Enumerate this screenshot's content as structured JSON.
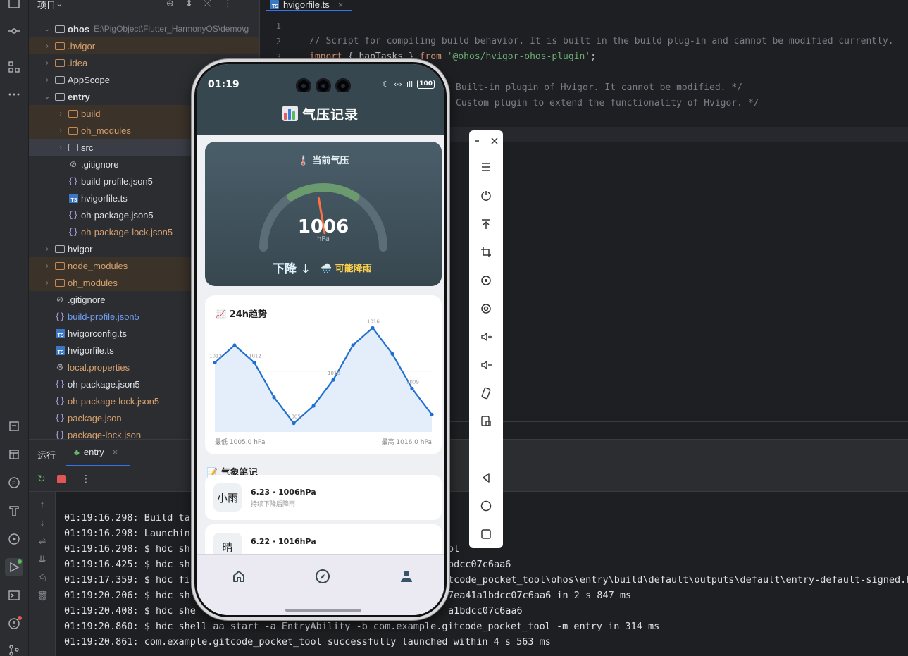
{
  "project": {
    "title": "项目",
    "root_name": "ohos",
    "root_path": "E:\\PigObject\\Flutter_HarmonyOS\\demo\\g",
    "tree": [
      {
        "label": ".hvigor",
        "type": "folder",
        "color": "orange",
        "depth": 1,
        "open": false,
        "hl": true
      },
      {
        "label": ".idea",
        "type": "folder",
        "color": "orange",
        "depth": 1,
        "open": false,
        "hl": false
      },
      {
        "label": "AppScope",
        "type": "folder",
        "color": "white",
        "depth": 1,
        "open": false,
        "hl": false
      },
      {
        "label": "entry",
        "type": "folder",
        "color": "white",
        "depth": 1,
        "open": true,
        "hl": false,
        "bold": true
      },
      {
        "label": "build",
        "type": "folder",
        "color": "orange",
        "depth": 2,
        "open": false,
        "hl": true
      },
      {
        "label": "oh_modules",
        "type": "folder",
        "color": "orange",
        "depth": 2,
        "open": false,
        "hl": true
      },
      {
        "label": "src",
        "type": "folder",
        "color": "white",
        "depth": 2,
        "open": false,
        "sel": true
      },
      {
        "label": ".gitignore",
        "type": "ignore",
        "color": "white",
        "depth": 2
      },
      {
        "label": "build-profile.json5",
        "type": "json",
        "color": "white",
        "depth": 2
      },
      {
        "label": "hvigorfile.ts",
        "type": "ts",
        "color": "white",
        "depth": 2
      },
      {
        "label": "oh-package.json5",
        "type": "json",
        "color": "white",
        "depth": 2
      },
      {
        "label": "oh-package-lock.json5",
        "type": "json",
        "color": "orange",
        "depth": 2
      },
      {
        "label": "hvigor",
        "type": "folder",
        "color": "white",
        "depth": 1,
        "open": false
      },
      {
        "label": "node_modules",
        "type": "folder",
        "color": "orange",
        "depth": 1,
        "open": false,
        "hl": true
      },
      {
        "label": "oh_modules",
        "type": "folder",
        "color": "orange",
        "depth": 1,
        "open": false,
        "hl": true
      },
      {
        "label": ".gitignore",
        "type": "ignore",
        "color": "white",
        "depth": 1
      },
      {
        "label": "build-profile.json5",
        "type": "json",
        "color": "blue",
        "depth": 1
      },
      {
        "label": "hvigorconfig.ts",
        "type": "ts",
        "color": "white",
        "depth": 1
      },
      {
        "label": "hvigorfile.ts",
        "type": "ts",
        "color": "white",
        "depth": 1
      },
      {
        "label": "local.properties",
        "type": "gear",
        "color": "orange",
        "depth": 1
      },
      {
        "label": "oh-package.json5",
        "type": "json",
        "color": "white",
        "depth": 1
      },
      {
        "label": "oh-package-lock.json5",
        "type": "json",
        "color": "orange",
        "depth": 1
      },
      {
        "label": "package.json",
        "type": "json",
        "color": "orange",
        "depth": 1
      },
      {
        "label": "package-lock.json",
        "type": "json",
        "color": "orange",
        "depth": 1
      }
    ]
  },
  "editor": {
    "tab_label": "hvigorfile.ts",
    "line_numbers": [
      "1",
      "2",
      "3"
    ],
    "code": {
      "line2": "// Script for compiling build behavior. It is built in the build plug-in and cannot be modified currently.",
      "line3_kw1": "import",
      "line3_mid": " { hapTasks } ",
      "line3_kw2": "from",
      "line3_str": "'@ohos/hvigor-ohos-plugin'",
      "line3_end": ";",
      "line5": "Built-in plugin of Hvigor. It cannot be modified. */",
      "line6": "Custom plugin to extend the functionality of Hvigor. */"
    }
  },
  "run": {
    "title": "运行",
    "tab_label": "entry",
    "console_left": [
      "01:19:16.298: Build ta",
      "01:19:16.298: Launchin",
      "01:19:16.298: $ hdc sh",
      "01:19:16.425: $ hdc sh",
      "01:19:17.359: $ hdc fi",
      "01:19:20.206: $ hdc sh",
      "01:19:20.408: $ hdc she",
      "01:19:20.860: $ hdc shell aa start -a EntryAbility -b com.example.gitcode_pocket_tool -m entry in 314 ms",
      "01:19:20.861: com.example.gitcode_pocket_tool successfully launched within 4 s 563 ms"
    ],
    "console_right": [
      "ol",
      "bdcc07c6aa6",
      "tcode_pocket_tool\\ohos\\entry\\build\\default\\outputs\\default\\entry-default-signed.ha",
      "7ea41a1bdcc07c6aa6 in 2 s 847 ms",
      "a1bdcc07c6aa6"
    ]
  },
  "phone": {
    "status": {
      "time": "01:19",
      "battery": "100"
    },
    "app_title": "气压记录",
    "current": {
      "label": "🌡️ 当前气压",
      "value": "1006",
      "unit": "hPa",
      "trend": "下降 ↓",
      "forecast": "🌧️ 可能降雨",
      "gauge_fraction": 0.5
    },
    "trend_card": {
      "title": "📈 24h趋势",
      "min_label": "最低 1005.0 hPa",
      "max_label": "最高 1016.0 hPa"
    },
    "notes_title": "📝 气象笔记",
    "notes": [
      {
        "badge": "小雨",
        "title": "6.23 · 1006hPa",
        "sub": "持续下降后降雨"
      },
      {
        "badge": "晴",
        "title": "6.22 · 1016hPa",
        "sub": ""
      }
    ],
    "nav": [
      "home-icon",
      "compass-icon",
      "person-icon"
    ]
  },
  "chart_data": {
    "type": "area",
    "x": [
      0,
      1,
      2,
      3,
      4,
      5,
      6,
      7,
      8,
      9,
      10,
      11
    ],
    "values": [
      1012,
      1014,
      1012,
      1008,
      1005,
      1007,
      1010,
      1014,
      1016,
      1013,
      1009,
      1006
    ],
    "point_labels": [
      "1012",
      "",
      "1012",
      "",
      "1005",
      "",
      "1010",
      "",
      "1016",
      "",
      "1009",
      ""
    ],
    "ylim": [
      1004,
      1017
    ],
    "color": "#1e6fd0",
    "fill": "#e4eefa"
  },
  "colors": {
    "ide_bg": "#1e1f22",
    "panel_bg": "#2b2d30",
    "accent": "#3574f0",
    "app_header": "#37474f",
    "forecast": "#ffd24d",
    "gauge_arc": "#6a9a6e",
    "needle": "#ff7043"
  }
}
